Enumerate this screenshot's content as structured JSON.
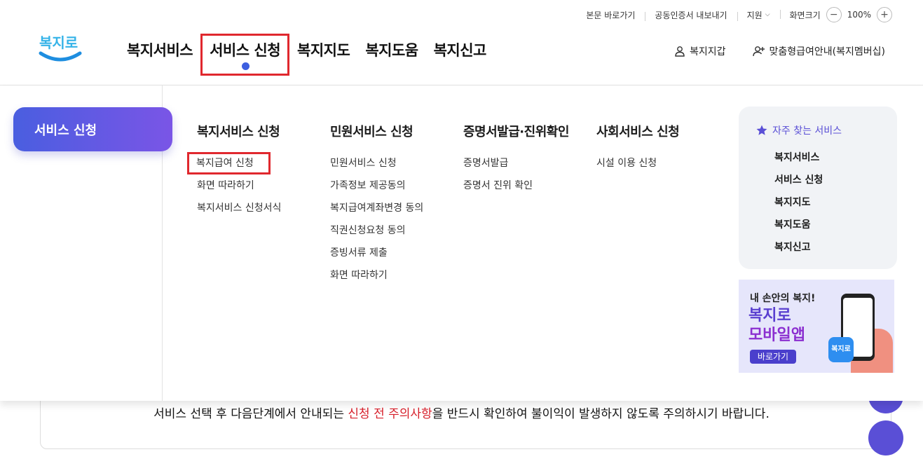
{
  "util": {
    "skip_link": "본문 바로가기",
    "cert_export": "공동인증서 내보내기",
    "support": "지원",
    "zoom_label": "화면크기",
    "zoom_minus": "−",
    "zoom_value": "100%",
    "zoom_plus": "+"
  },
  "header": {
    "logo_text": "복지로",
    "nav": [
      "복지서비스",
      "서비스 신청",
      "복지지도",
      "복지도움",
      "복지신고"
    ],
    "wallet": "복지지갑",
    "membership": "맞춤형급여안내(복지멤버십)"
  },
  "mega": {
    "side_title": "서비스 신청",
    "columns": [
      {
        "title": "복지서비스 신청",
        "links": [
          "복지급여 신청",
          "화면 따라하기",
          "복지서비스 신청서식"
        ]
      },
      {
        "title": "민원서비스 신청",
        "links": [
          "민원서비스 신청",
          "가족정보 제공동의",
          "복지급여계좌변경 동의",
          "직권신청요청 동의",
          "증빙서류 제출",
          "화면 따라하기"
        ]
      },
      {
        "title": "증명서발급·진위확인",
        "links": [
          "증명서발급",
          "증명서 진위 확인"
        ]
      },
      {
        "title": "사회서비스 신청",
        "links": [
          "시설 이용 신청"
        ]
      }
    ],
    "favorites": {
      "title": "자주 찾는 서비스",
      "links": [
        "복지서비스",
        "서비스 신청",
        "복지지도",
        "복지도움",
        "복지신고"
      ]
    },
    "banner": {
      "line1": "내 손안의 복지!",
      "line2": "복지로",
      "line3": "모바일앱",
      "button": "바로가기",
      "app_label": "복지로"
    }
  },
  "content": {
    "notice_before": "서비스 선택 후 다음단계에서 안내되는 ",
    "notice_highlight": "신청 전 주의사항",
    "notice_after": "을 반드시 확인하여 불이익이 발생하지 않도록 주의하시기 바랍니다."
  },
  "colors": {
    "accent": "#5a4fd6",
    "active_dot": "#3d5fe0",
    "highlight_box": "#e0282e",
    "notice_red": "#d71f2a"
  }
}
